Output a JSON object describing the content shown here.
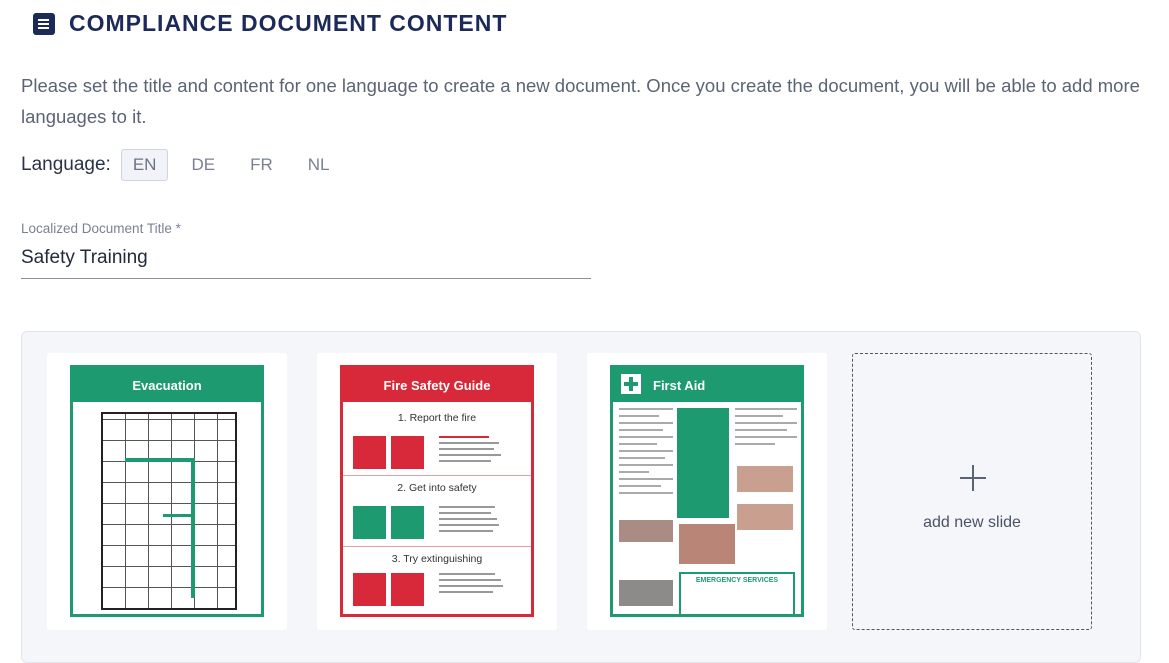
{
  "header": {
    "title": "COMPLIANCE DOCUMENT CONTENT",
    "icon": "document-list-icon"
  },
  "description": "Please set the title and content for one language to create a new document. Once you create the document, you will be able to add more languages to it.",
  "language": {
    "label": "Language:",
    "options": [
      "EN",
      "DE",
      "FR",
      "NL"
    ],
    "selected": "EN"
  },
  "title_field": {
    "label": "Localized Document Title *",
    "value": "Safety Training"
  },
  "slides": [
    {
      "title": "Evacuation",
      "color": "#1e9a70"
    },
    {
      "title": "Fire Safety Guide",
      "color": "#d8293a",
      "steps": [
        "1. Report the fire",
        "2. Get into safety",
        "3. Try extinguishing"
      ]
    },
    {
      "title": "First Aid",
      "color": "#1e9a70",
      "box": "EMERGENCY SERVICES"
    }
  ],
  "add_slide_label": "add new slide"
}
